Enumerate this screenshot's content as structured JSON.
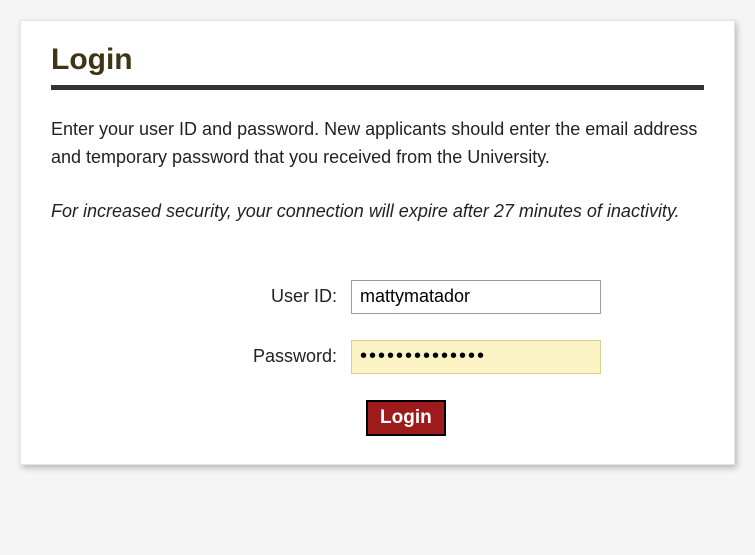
{
  "title": "Login",
  "instructions": "Enter your user ID and password. New applicants should enter the email address and temporary password that you received from the University.",
  "security_note": "For increased security, your connection will expire after 27 minutes of inactivity.",
  "form": {
    "user_id": {
      "label": "User ID:",
      "value": "mattymatador"
    },
    "password": {
      "label": "Password:",
      "value": "••••••••••••••"
    },
    "submit_label": "Login"
  }
}
